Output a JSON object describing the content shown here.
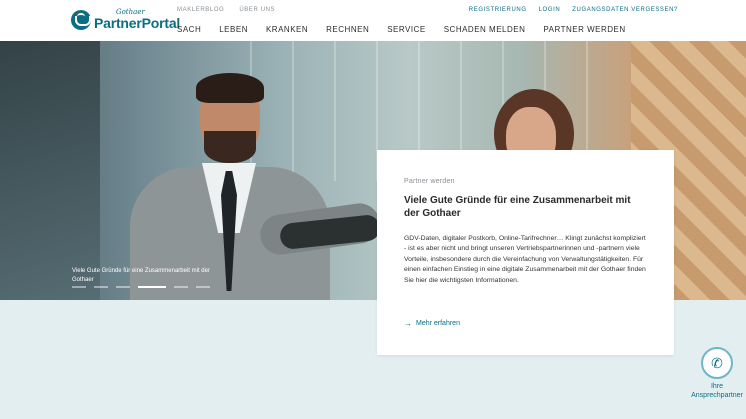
{
  "brand": {
    "small": "Gothaer",
    "name": "PartnerPortal"
  },
  "meta_nav": [
    {
      "label": "MAKLERBLOG"
    },
    {
      "label": "ÜBER UNS"
    }
  ],
  "util_nav": [
    {
      "label": "REGISTRIERUNG"
    },
    {
      "label": "LOGIN"
    },
    {
      "label": "ZUGANGSDATEN VERGESSEN?"
    }
  ],
  "main_nav": [
    {
      "label": "SACH"
    },
    {
      "label": "LEBEN"
    },
    {
      "label": "KRANKEN"
    },
    {
      "label": "RECHNEN"
    },
    {
      "label": "SERVICE"
    },
    {
      "label": "SCHADEN MELDEN"
    },
    {
      "label": "PARTNER WERDEN"
    }
  ],
  "hero": {
    "caption": "Viele Gute Gründe für eine Zusammenarbeit mit der Gothaer",
    "slides_total": 6,
    "active_slide": 4
  },
  "card": {
    "eyebrow": "Partner werden",
    "title": "Viele Gute Gründe für eine Zusammenarbeit mit der Gothaer",
    "body": "GDV-Daten, digitaler Postkorb, Online-Tarifrechner… Klingt zunächst kompliziert - ist es aber nicht und bringt unseren Vertriebspartnerinnen und -partnern viele Vorteile, insbesondere durch die Vereinfachung von Verwaltungstätigkeiten. Für einen einfachen Einstieg in eine digitale Zusammenarbeit mit der Gothaer finden Sie hier die wichtigsten Informationen.",
    "link": "Mehr erfahren"
  },
  "contact": {
    "line1": "Ihre",
    "line2": "Ansprechpartner"
  },
  "colors": {
    "accent": "#0b6e83",
    "light_bg": "#e3eef1"
  },
  "icons": {
    "phone": "phone-icon",
    "arrow": "arrow-right-icon"
  }
}
